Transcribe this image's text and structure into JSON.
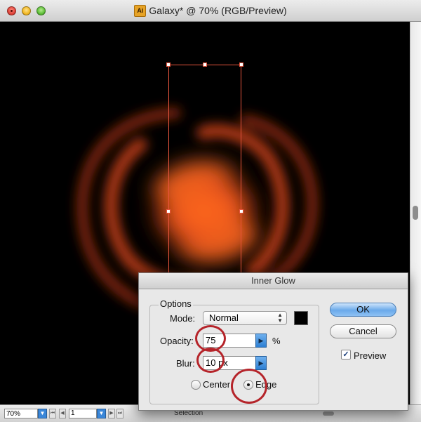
{
  "window": {
    "title": "Galaxy* @ 70% (RGB/Preview)",
    "app_icon": "Ai"
  },
  "status": {
    "zoom": "70%",
    "page": "1",
    "tool": "Selection"
  },
  "dialog": {
    "title": "Inner Glow",
    "options_label": "Options",
    "mode_label": "Mode:",
    "mode_value": "Normal",
    "opacity_label": "Opacity:",
    "opacity_value": "75",
    "opacity_unit": "%",
    "blur_label": "Blur:",
    "blur_value": "10 px",
    "center_label": "Center",
    "edge_label": "Edge",
    "ok_label": "OK",
    "cancel_label": "Cancel",
    "preview_label": "Preview",
    "preview_checked": true,
    "selected_glow_origin": "Edge",
    "glow_color": "#000000"
  },
  "colors": {
    "galaxy_core": "#ff6a1f",
    "galaxy_arm": "#c43d12",
    "selection": "#e8553e",
    "annotation": "#b5242a"
  }
}
